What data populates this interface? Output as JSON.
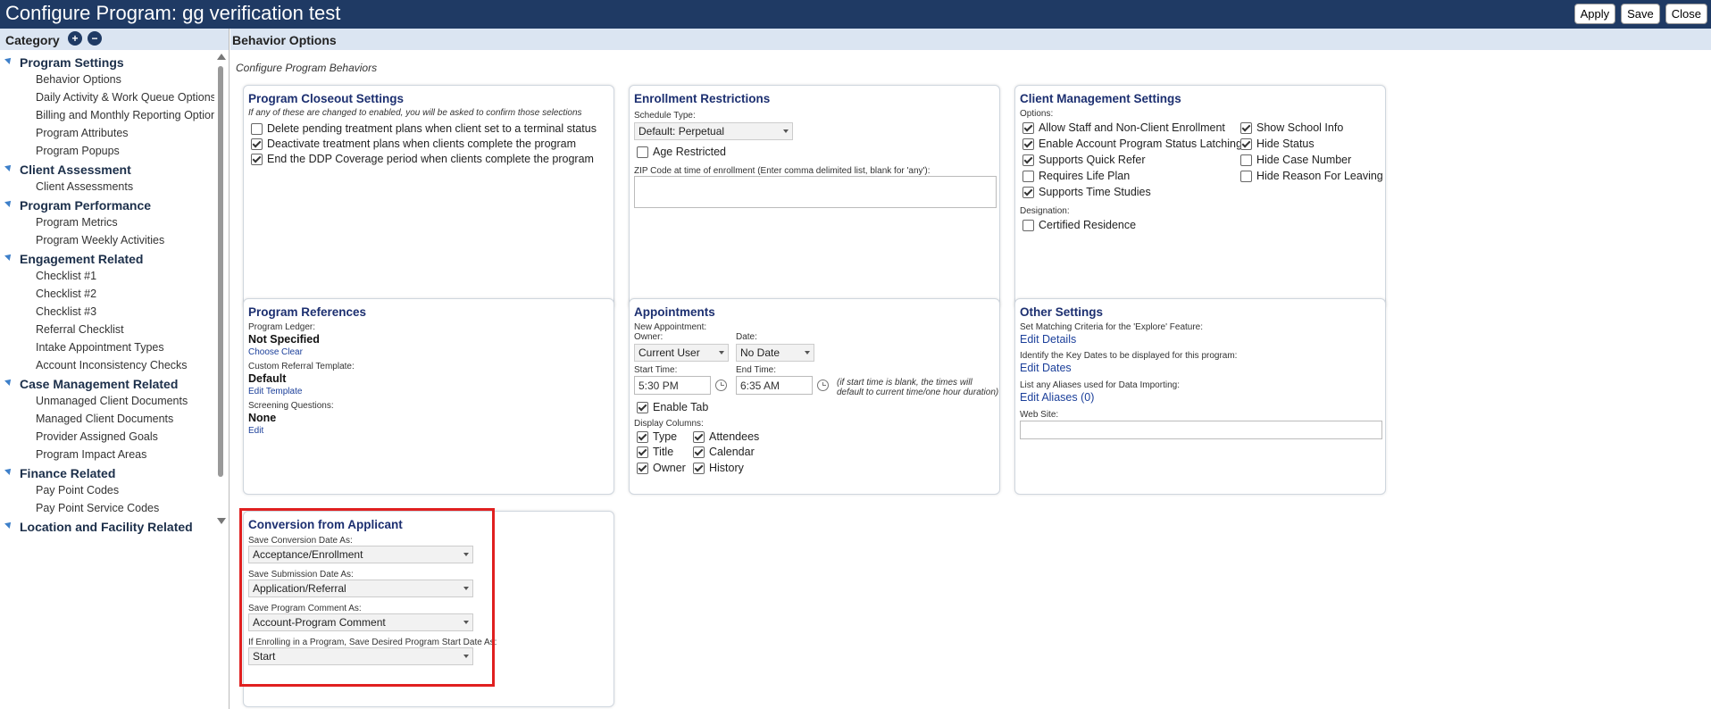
{
  "window": {
    "title": "Configure Program: gg verification test",
    "buttons": {
      "apply": "Apply",
      "save": "Save",
      "close": "Close"
    }
  },
  "sidebar": {
    "header": "Category",
    "header_icons": [
      "expand-all-icon",
      "collapse-all-icon"
    ],
    "groups": [
      {
        "label": "Program Settings",
        "items": [
          "Behavior Options",
          "Daily Activity & Work Queue Options",
          "Billing and Monthly Reporting Option",
          "Program Attributes",
          "Program Popups"
        ]
      },
      {
        "label": "Client Assessment",
        "items": [
          "Client Assessments"
        ]
      },
      {
        "label": "Program Performance",
        "items": [
          "Program Metrics",
          "Program Weekly Activities"
        ]
      },
      {
        "label": "Engagement Related",
        "items": [
          "Checklist #1",
          "Checklist #2",
          "Checklist #3",
          "Referral Checklist",
          "Intake Appointment Types",
          "Account Inconsistency Checks"
        ]
      },
      {
        "label": "Case Management Related",
        "items": [
          "Unmanaged Client Documents",
          "Managed Client Documents",
          "Provider Assigned Goals",
          "Program Impact Areas"
        ]
      },
      {
        "label": "Finance Related",
        "items": [
          "Pay Point Codes",
          "Pay Point Service Codes"
        ]
      },
      {
        "label": "Location and Facility Related",
        "items": []
      }
    ]
  },
  "main": {
    "header": "Behavior Options",
    "subheader": "Configure Program Behaviors",
    "closeout": {
      "title": "Program Closeout Settings",
      "note": "If any of these are changed to enabled, you will be asked to confirm those selections",
      "options": [
        {
          "label": "Delete pending treatment plans when client set to a terminal status",
          "checked": false
        },
        {
          "label": "Deactivate treatment plans when clients complete the program",
          "checked": true
        },
        {
          "label": "End the DDP Coverage period when clients complete the program",
          "checked": true
        }
      ]
    },
    "enrollment": {
      "title": "Enrollment Restrictions",
      "schedule_label": "Schedule Type:",
      "schedule_value": "Default: Perpetual",
      "age_restricted": "Age Restricted",
      "zip_label": "ZIP Code at time of enrollment (Enter comma delimited list, blank for 'any'):"
    },
    "client_mgmt": {
      "title": "Client Management Settings",
      "options_label": "Options:",
      "options_left": [
        {
          "label": "Allow Staff and Non-Client Enrollment",
          "checked": true
        },
        {
          "label": "Enable Account Program Status Latching",
          "checked": true
        },
        {
          "label": "Supports Quick Refer",
          "checked": true
        },
        {
          "label": "Requires Life Plan",
          "checked": false
        },
        {
          "label": "Supports Time Studies",
          "checked": true
        }
      ],
      "options_right": [
        {
          "label": "Show School Info",
          "checked": true
        },
        {
          "label": "Hide Status",
          "checked": true
        },
        {
          "label": "Hide Case Number",
          "checked": false
        },
        {
          "label": "Hide Reason For Leaving",
          "checked": false
        }
      ],
      "designation_label": "Designation:",
      "certified": "Certified Residence"
    },
    "references": {
      "title": "Program References",
      "ledger_label": "Program Ledger:",
      "ledger_value": "Not Specified",
      "choose": "Choose",
      "clear": "Clear",
      "referral_label": "Custom Referral Template:",
      "referral_value": "Default",
      "edit_template": "Edit Template",
      "screening_label": "Screening Questions:",
      "screening_value": "None",
      "edit": "Edit"
    },
    "appointments": {
      "title": "Appointments",
      "new_label": "New Appointment:",
      "owner_label": "Owner:",
      "owner_value": "Current User",
      "date_label": "Date:",
      "date_value": "No Date",
      "start_label": "Start Time:",
      "start_value": "5:30 PM",
      "end_label": "End Time:",
      "end_value": "6:35 AM",
      "note_line1": "(if start time is blank, the times will",
      "note_line2": "default to current time/one hour duration)",
      "enable_tab": "Enable Tab",
      "display_label": "Display Columns:",
      "columns_left": [
        "Type",
        "Title",
        "Owner"
      ],
      "columns_right": [
        "Attendees",
        "Calendar",
        "History"
      ]
    },
    "other": {
      "title": "Other Settings",
      "matching_label": "Set Matching Criteria for the 'Explore' Feature:",
      "edit_details": "Edit Details",
      "keydates_label": "Identify the Key Dates to be displayed for this program:",
      "edit_dates": "Edit Dates",
      "aliases_label": "List any Aliases used for Data Importing:",
      "edit_aliases": "Edit Aliases (0)",
      "website_label": "Web Site:"
    },
    "conversion": {
      "title": "Conversion from Applicant",
      "conv_label": "Save Conversion Date As:",
      "conv_value": "Acceptance/Enrollment",
      "sub_label": "Save Submission Date As:",
      "sub_value": "Application/Referral",
      "comment_label": "Save Program Comment As:",
      "comment_value": "Account-Program Comment",
      "start_label": "If Enrolling in a Program, Save Desired Program Start Date As:",
      "start_value": "Start"
    }
  },
  "colors": {
    "titlebar": "#1f3a64",
    "header_bg": "#dbe5f2",
    "panel_title": "#1c2f70",
    "link": "#1b3f9a",
    "highlight": "#e02020"
  }
}
